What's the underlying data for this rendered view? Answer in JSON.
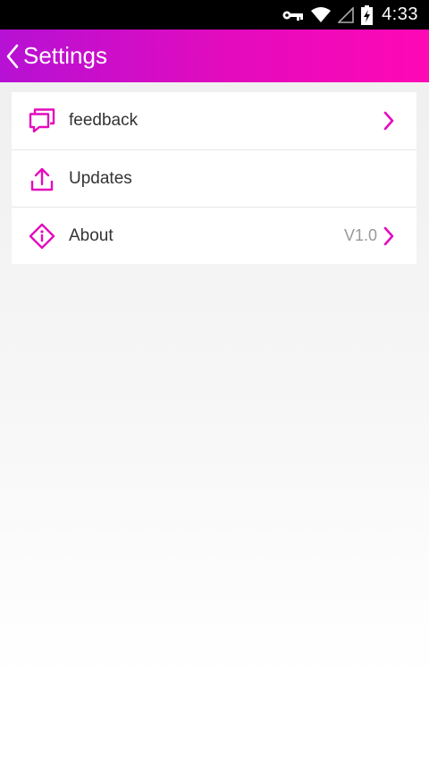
{
  "status_bar": {
    "time": "4:33",
    "icons": [
      "vpn-key-icon",
      "wifi-icon",
      "signal-icon",
      "battery-charging-icon"
    ]
  },
  "app_bar": {
    "back_icon": "chevron-left-icon",
    "title": "Settings"
  },
  "settings": {
    "items": [
      {
        "icon": "feedback-icon",
        "label": "feedback",
        "value": "",
        "has_chevron": true
      },
      {
        "icon": "upload-icon",
        "label": "Updates",
        "value": "",
        "has_chevron": false
      },
      {
        "icon": "info-diamond-icon",
        "label": "About",
        "value": "V1.0",
        "has_chevron": true
      }
    ]
  },
  "colors": {
    "accent": "#e40bbd",
    "app_bar_start": "#b611d4",
    "app_bar_end": "#ff08b5",
    "status_bar": "#000000",
    "text_primary": "#333333",
    "text_secondary": "#999999"
  }
}
